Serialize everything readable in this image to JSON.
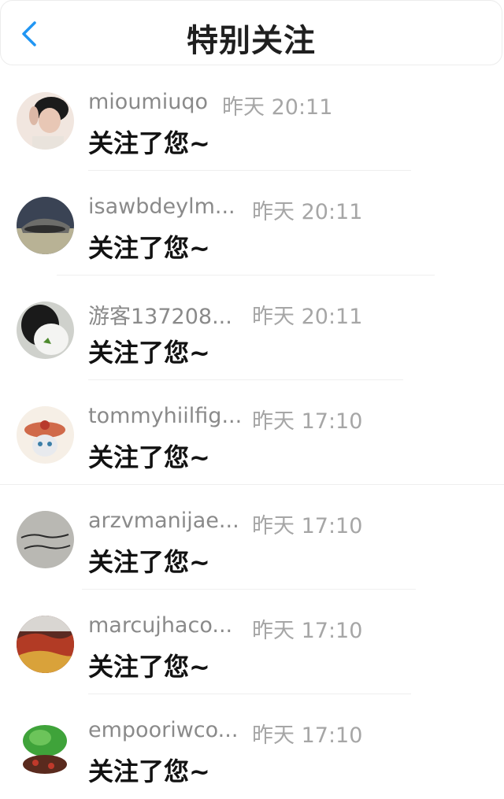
{
  "header": {
    "title": "特别关注",
    "back_icon": "chevron-left-icon",
    "accent": "#2196f3"
  },
  "items": [
    {
      "name": "mioumiuqo",
      "time": "昨天 20:11",
      "message": "关注了您~"
    },
    {
      "name": "isawbdeylm...",
      "time": "昨天 20:11",
      "message": "关注了您~"
    },
    {
      "name": "游客137208...",
      "time": "昨天 20:11",
      "message": "关注了您~"
    },
    {
      "name": "tommyhiilfig...",
      "time": "昨天 17:10",
      "message": "关注了您~"
    },
    {
      "name": "arzvmanijae...",
      "time": "昨天 17:10",
      "message": "关注了您~"
    },
    {
      "name": "marcujhaco...",
      "time": "昨天 17:10",
      "message": "关注了您~"
    },
    {
      "name": "empooriwco...",
      "time": "昨天 17:10",
      "message": "关注了您~"
    }
  ]
}
